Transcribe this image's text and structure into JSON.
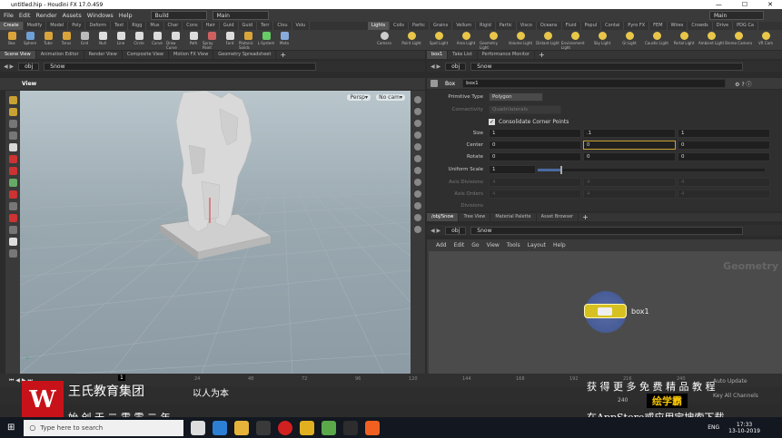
{
  "window": {
    "title": "untitled.hip - Houdini FX 17.0.459",
    "min": "—",
    "max": "☐",
    "close": "✕"
  },
  "menubar": {
    "items": [
      "File",
      "Edit",
      "Render",
      "Assets",
      "Windows",
      "Help"
    ],
    "desktop": "Build",
    "main": "Main",
    "right_main": "Main"
  },
  "shelf_tabs_left": [
    "Create",
    "Modify",
    "Model",
    "Poly",
    "Deform",
    "Text",
    "Rigg",
    "Mus",
    "Char",
    "Cons",
    "Hair",
    "Guid",
    "Guid",
    "Terr",
    "Clou",
    "Volu"
  ],
  "shelf_tabs_right": [
    "Lights",
    "Colis",
    "Partic",
    "Grains",
    "Vellum",
    "Rigid",
    "Partic",
    "Visco",
    "Oceans",
    "Fluid",
    "Popul",
    "Contai",
    "Pyro FX",
    "FEM",
    "Wires",
    "Crowds",
    "Drive",
    "PDG Ca"
  ],
  "shelf_tools_left": [
    "Box",
    "Sphere",
    "Tube",
    "Torus",
    "Grid",
    "Null",
    "Line",
    "Circle",
    "Curve",
    "Draw Curve",
    "Path",
    "Spray Paint",
    "Font",
    "Platonic Solids",
    "L-System",
    "Meta"
  ],
  "shelf_tools_right": [
    "Camera",
    "Point Light",
    "Spot Light",
    "Area Light",
    "Geometry Light",
    "Volume Light",
    "Distant Light",
    "Environment Light",
    "Sky Light",
    "GI Light",
    "Caustic Light",
    "Portal Light",
    "Ambient Light",
    "Stereo Camera",
    "VR Cam"
  ],
  "left_pane": {
    "tabs": [
      "Scene View",
      "Animation Editor",
      "Render View",
      "Composite View",
      "Motion FX View",
      "Geometry Spreadsheet"
    ],
    "path_obj": "obj",
    "path_node": "Snow",
    "view_label": "View",
    "persp": "Persp▾",
    "cam": "No cam▾"
  },
  "right_top": {
    "tabs": [
      "box1",
      "Take List",
      "Performance Monitor"
    ],
    "path_obj": "obj",
    "path_node": "Snow",
    "node_type": "Box",
    "node_name": "box1",
    "params": {
      "primitive_type_label": "Primitive Type",
      "primitive_type_value": "Polygon",
      "connectivity_label": "Connectivity",
      "connectivity_value": "Quadrilaterals",
      "consolidate": "Consolidate Corner Points",
      "size_label": "Size",
      "size": [
        "1",
        ".1",
        "1"
      ],
      "center_label": "Center",
      "center": [
        "0",
        "0",
        "0"
      ],
      "rotate_label": "Rotate",
      "rotate": [
        "0",
        "0",
        "0"
      ],
      "uniform_scale_label": "Uniform Scale",
      "uniform_scale": "1",
      "axis_divisions_label": "Axis Divisions",
      "axis_divisions": [
        "4",
        "4",
        "4"
      ],
      "axis_orders_label": "Axis Orders",
      "axis_orders": [
        "4",
        "4",
        "4"
      ],
      "divisions_label": "Divisions"
    }
  },
  "right_bottom": {
    "tabs": [
      "/obj/Snow",
      "Tree View",
      "Material Palette",
      "Asset Browser"
    ],
    "path_obj": "obj",
    "path_node": "Snow",
    "menu": [
      "Add",
      "Edit",
      "Go",
      "View",
      "Tools",
      "Layout",
      "Help"
    ],
    "context_label": "Geometry",
    "node_label": "box1"
  },
  "timeline": {
    "frame": "1",
    "ticks": [
      "24",
      "48",
      "72",
      "96",
      "120",
      "144",
      "168",
      "192",
      "216",
      "240"
    ],
    "end_frame": "240",
    "keys_label": "Auto Update",
    "channels": "Key All Channels"
  },
  "overlay": {
    "brand_cn": "王氏教育集团",
    "slogan_cn": "以人为本",
    "founded_cn": "始 创 于 二 零 零 二 年",
    "promo1": "获 得 更 多 免 费 精 品 教 程",
    "promo2_brand": "绘学霸",
    "promo3": "在AppStore或应用宝搜索下载"
  },
  "taskbar": {
    "search_placeholder": "Type here to search",
    "lang": "ENG",
    "time": "17:33",
    "date": "13-10-2019"
  },
  "colors": {
    "accent": "#f0b400",
    "node_ring": "#6b8fd6",
    "selected_node": "#e0c000",
    "viewport_top": "#b9c6cc",
    "viewport_bottom": "#8d9ba5"
  }
}
